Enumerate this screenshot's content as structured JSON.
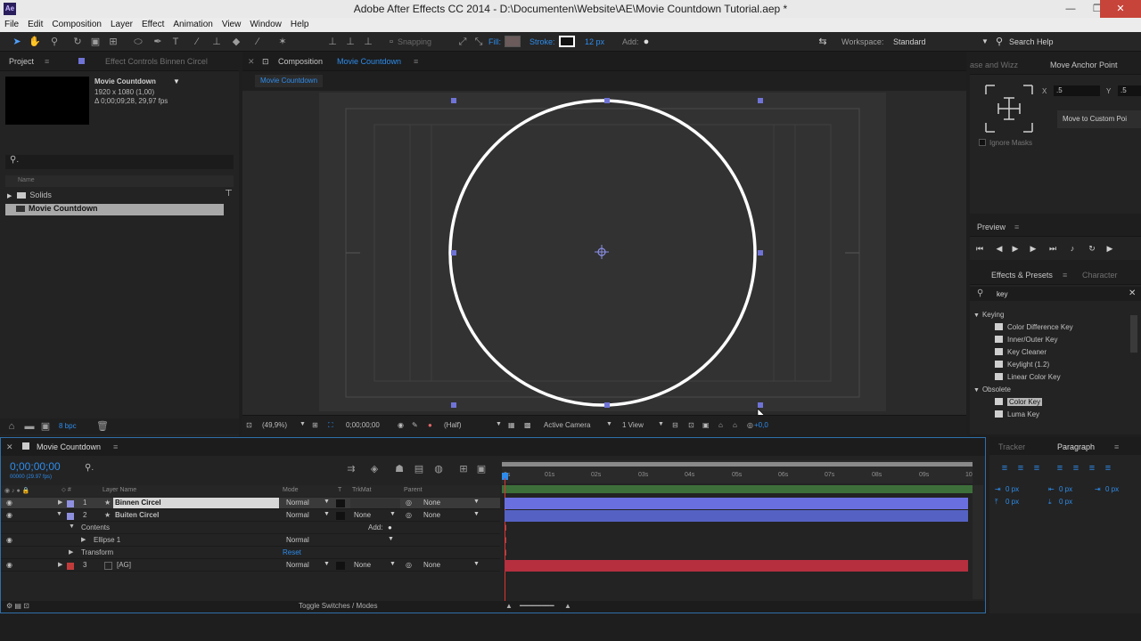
{
  "window": {
    "title": "Adobe After Effects CC 2014 - D:\\Documenten\\Website\\AE\\Movie Countdown Tutorial.aep *",
    "logo": "Ae",
    "minimize": "—",
    "maximize": "❐",
    "close": "✕"
  },
  "menu": [
    "File",
    "Edit",
    "Composition",
    "Layer",
    "Effect",
    "Animation",
    "View",
    "Window",
    "Help"
  ],
  "toolbar": {
    "snapping_label": "Snapping",
    "fill_label": "Fill:",
    "stroke_label": "Stroke:",
    "stroke_width": "12 px",
    "add_label": "Add:",
    "workspace_label": "Workspace:",
    "workspace_value": "Standard",
    "search_placeholder": "Search Help"
  },
  "project": {
    "tab": "Project",
    "effect_controls_tab": "Effect Controls Binnen Circel",
    "comp_name": "Movie Countdown",
    "comp_size": "1920 x 1080 (1,00)",
    "comp_duration": "Δ 0;00;09;28, 29,97 fps",
    "search_icon_text": "⚲.",
    "column_name": "Name",
    "items": [
      {
        "name": "Solids",
        "type": "folder"
      },
      {
        "name": "Movie Countdown",
        "type": "comp"
      }
    ],
    "bpc": "8 bpc"
  },
  "composition": {
    "tab_label": "Composition",
    "tab_name": "Movie Countdown",
    "breadcrumb": "Movie Countdown",
    "zoom": "(49,9%)",
    "timecode": "0;00;00;00",
    "resolution": "(Half)",
    "camera": "Active Camera",
    "views": "1 View",
    "offset": "+0,0"
  },
  "align_panel": {
    "left_tab": "ase and Wizz",
    "tab": "Move Anchor Point",
    "x_label": "X",
    "x_value": ".5",
    "y_label": "Y",
    "y_value": ".5",
    "button": "Move to Custom Poi",
    "ignore_masks": "Ignore Masks"
  },
  "preview": {
    "tab": "Preview"
  },
  "effects": {
    "tab": "Effects & Presets",
    "tab2": "Character",
    "search": "key",
    "categories": [
      {
        "name": "Keying",
        "items": [
          "Color Difference Key",
          "Inner/Outer Key",
          "Key Cleaner",
          "Keylight (1.2)",
          "Linear Color Key"
        ]
      },
      {
        "name": "Obsolete",
        "items": [
          "Color Key",
          "Luma Key"
        ]
      }
    ],
    "selected": "Color Key"
  },
  "timeline": {
    "tab": "Movie Countdown",
    "timecode": "0;00;00;00",
    "fps": "00000 (29.97 fps)",
    "col_layer_name": "Layer Name",
    "col_mode": "Mode",
    "col_t": "T",
    "col_trkmat": "TrkMat",
    "col_parent": "Parent",
    "ticks": [
      "0s",
      "01s",
      "02s",
      "03s",
      "04s",
      "05s",
      "06s",
      "07s",
      "08s",
      "09s",
      "10"
    ],
    "layers": [
      {
        "num": "1",
        "name": "Binnen Circel",
        "mode": "Normal",
        "trkmat": "",
        "parent": "None",
        "color": "#8f8fe0"
      },
      {
        "num": "2",
        "name": "Buiten Circel",
        "mode": "Normal",
        "trkmat": "None",
        "parent": "None",
        "color": "#8f8fe0"
      },
      {
        "num": "3",
        "name": "[AG]",
        "mode": "Normal",
        "trkmat": "None",
        "parent": "None",
        "color": "#c23b3b"
      }
    ],
    "contents_label": "Contents",
    "add_label": "Add:",
    "ellipse_label": "Ellipse 1",
    "ellipse_mode": "Normal",
    "transform_label": "Transform",
    "reset_label": "Reset",
    "footer": "Toggle Switches / Modes"
  },
  "tracker": {
    "tab": "Tracker",
    "tab2": "Paragraph",
    "values": [
      "0 px",
      "0 px",
      "0 px",
      "0 px",
      "0 px"
    ]
  },
  "colors": {
    "accent": "#2d8ceb",
    "layer_blue": "#5562c4",
    "layer_red": "#b52f3f",
    "circle": "#ffffff"
  }
}
